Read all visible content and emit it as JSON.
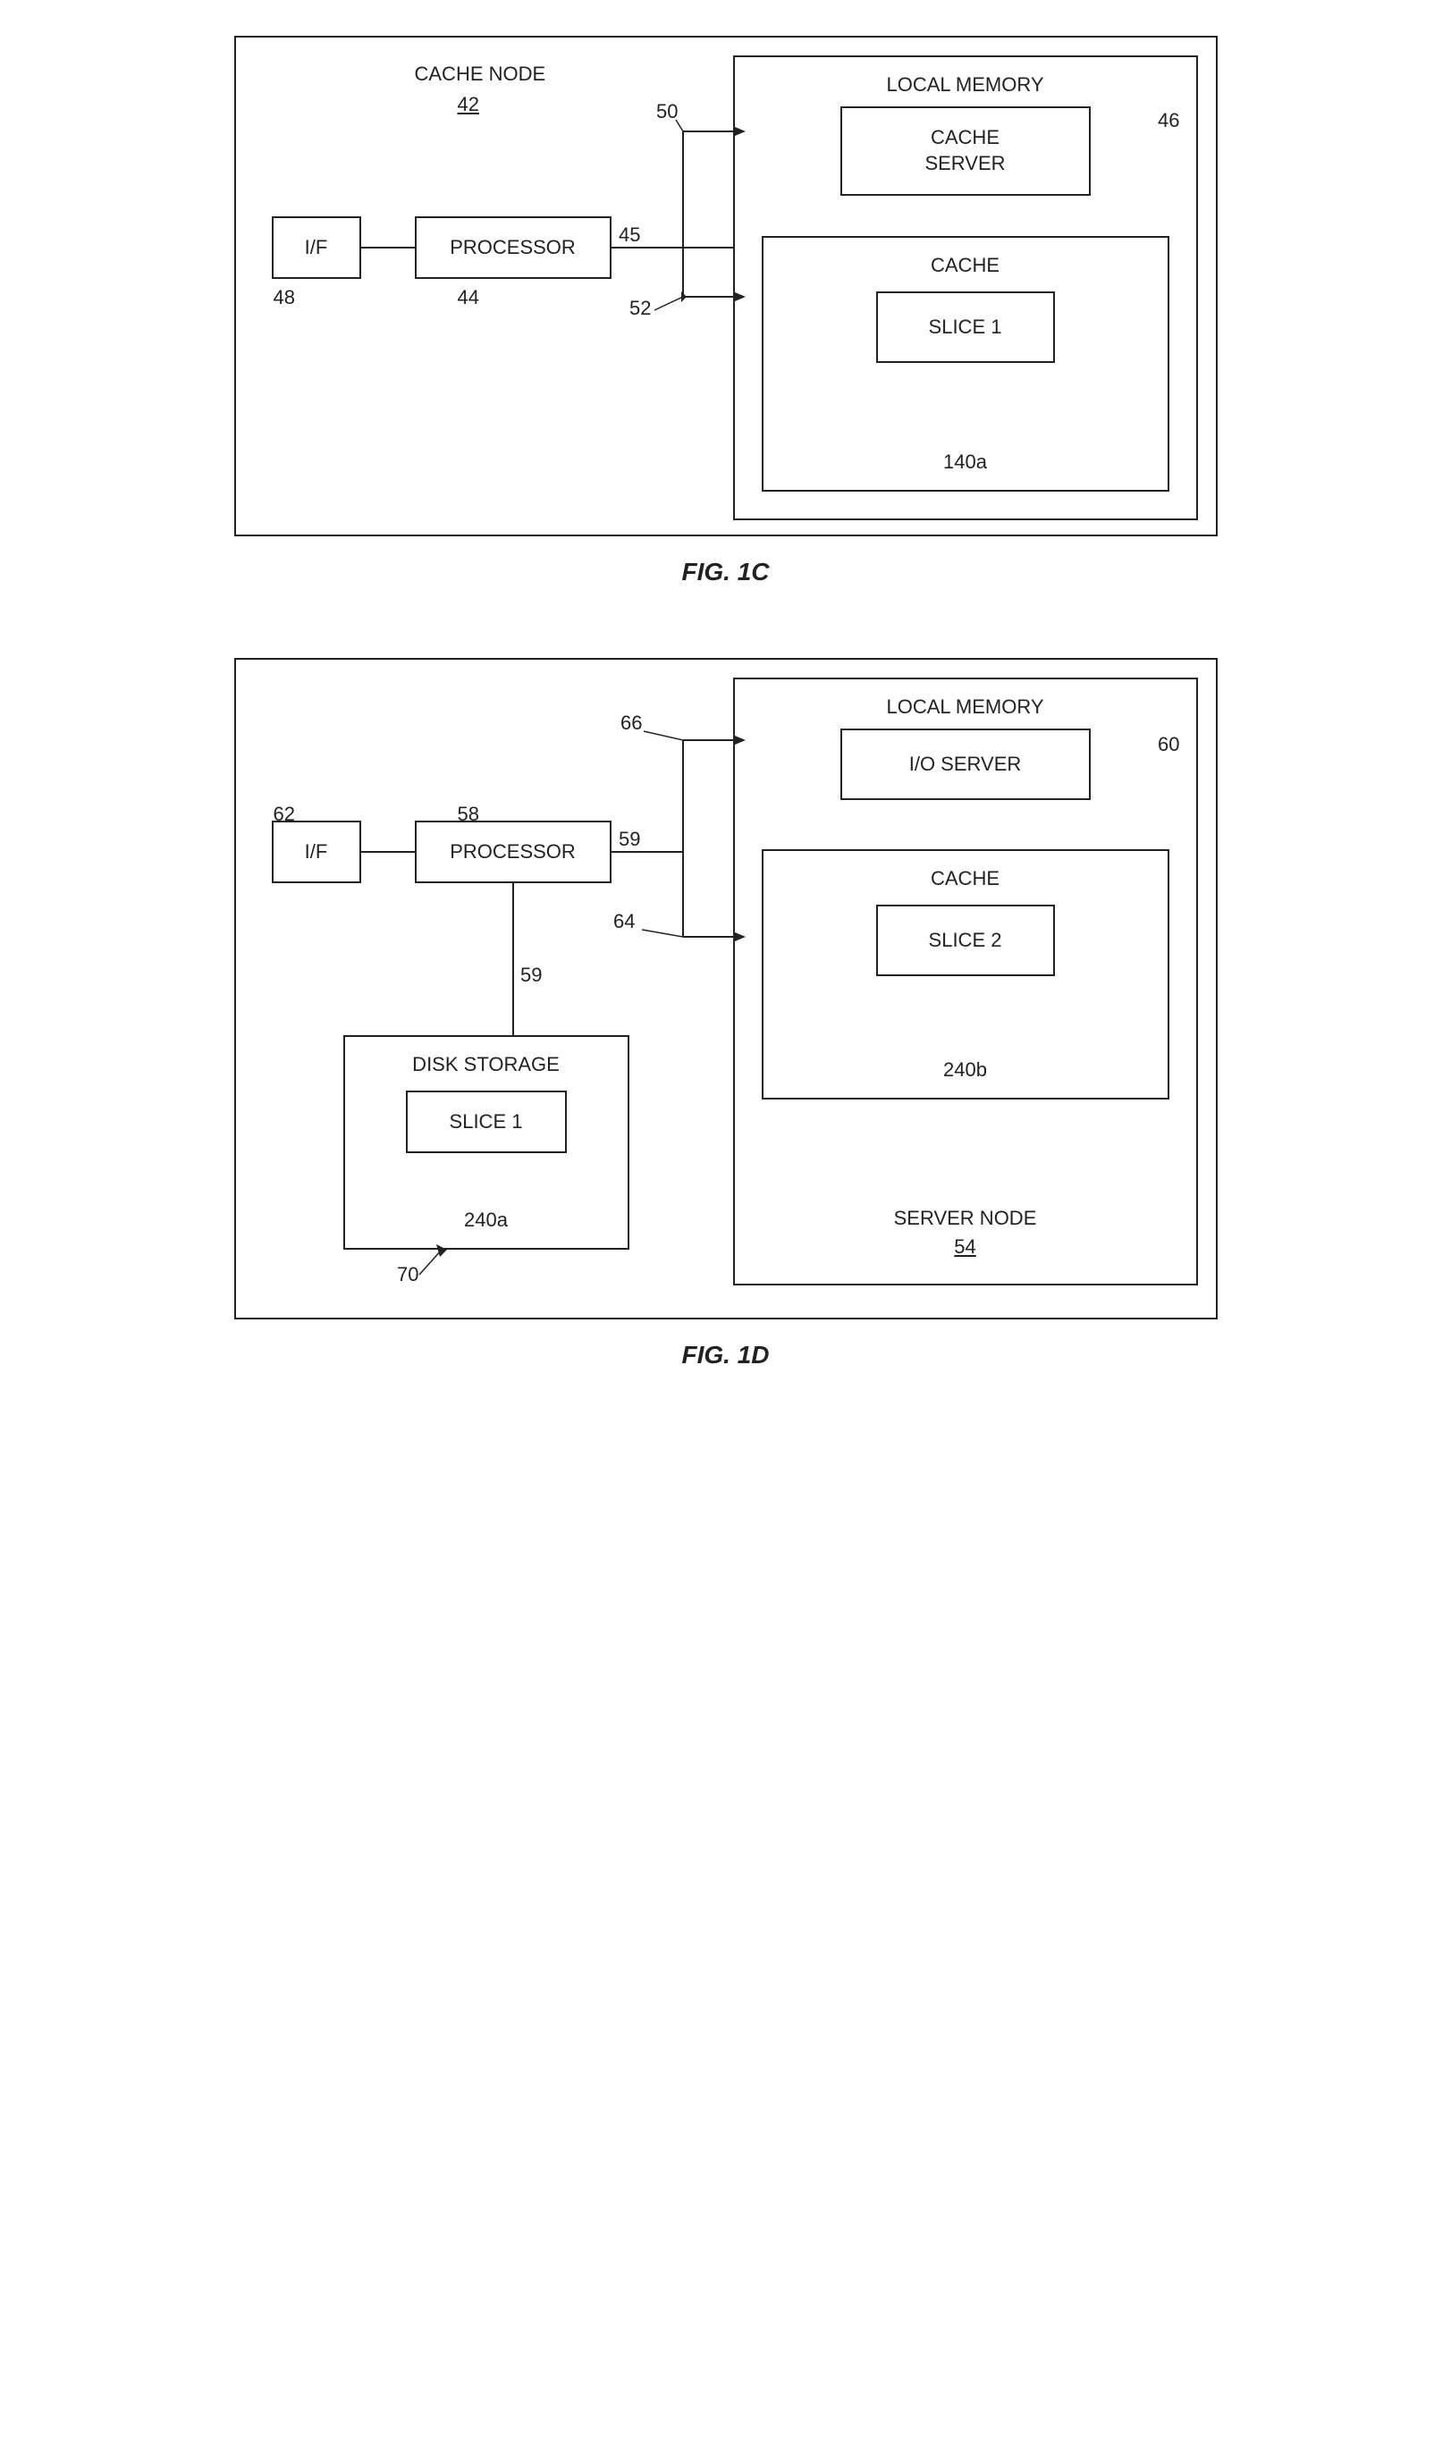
{
  "fig1c": {
    "title": "FIG. 1C",
    "outer_label": "CACHE NODE",
    "outer_number": "42",
    "if_label": "I/F",
    "if_number": "48",
    "processor_label": "PROCESSOR",
    "processor_number": "44",
    "connector_45": "45",
    "connector_50": "50",
    "connector_52": "52",
    "local_memory_label": "LOCAL MEMORY",
    "cache_server_label": "CACHE\nSERVER",
    "cache_server_number": "46",
    "cache_label": "CACHE",
    "slice1_label": "SLICE 1",
    "slice1_number": "140a"
  },
  "fig1d": {
    "title": "FIG. 1D",
    "if_label": "I/F",
    "if_number": "62",
    "processor_label": "PROCESSOR",
    "processor_number": "58",
    "connector_59a": "59",
    "connector_59b": "59",
    "connector_66": "66",
    "connector_64": "64",
    "local_memory_label": "LOCAL MEMORY",
    "io_server_label": "I/O SERVER",
    "io_server_number": "60",
    "cache_label": "CACHE",
    "slice2_label": "SLICE 2",
    "slice2_number": "240b",
    "disk_storage_label": "DISK STORAGE",
    "disk_slice1_label": "SLICE 1",
    "disk_slice1_number": "240a",
    "connector_70": "70",
    "server_node_label": "SERVER NODE",
    "server_node_number": "54"
  }
}
